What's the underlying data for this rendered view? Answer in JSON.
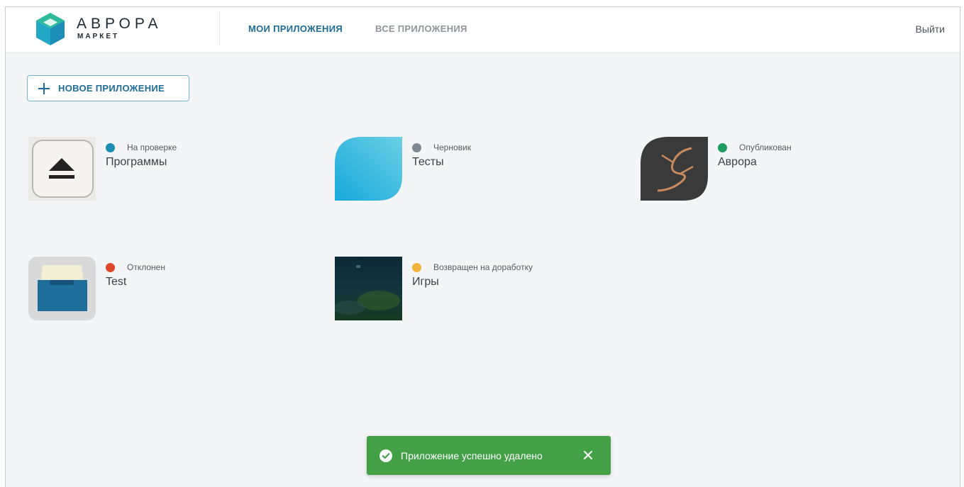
{
  "header": {
    "logo_title": "АВРОРА",
    "logo_subtitle": "МАРКЕТ",
    "tabs": [
      {
        "label": "МОИ ПРИЛОЖЕНИЯ",
        "active": true
      },
      {
        "label": "ВСЕ ПРИЛОЖЕНИЯ",
        "active": false
      }
    ],
    "logout_label": "Выйти"
  },
  "toolbar": {
    "new_app_label": "НОВОЕ ПРИЛОЖЕНИЕ",
    "new_app_icon": "plus-icon"
  },
  "apps": [
    {
      "name": "Программы",
      "status": "На проверке",
      "status_color": "#1e8db3",
      "icon": "eject-icon"
    },
    {
      "name": "Тесты",
      "status": "Черновик",
      "status_color": "#7d8892",
      "icon": "leaf-icon"
    },
    {
      "name": "Аврора",
      "status": "Опубликован",
      "status_color": "#1e9b5e",
      "icon": "bird-icon"
    },
    {
      "name": "Test",
      "status": "Отклонен",
      "status_color": "#e0462a",
      "icon": "drawer-icon"
    },
    {
      "name": "Игры",
      "status": "Возвращен на доработку",
      "status_color": "#f0b43c",
      "icon": "game-screenshot-icon"
    }
  ],
  "toast": {
    "message": "Приложение успешно удалено",
    "icon": "check-circle-icon",
    "close_icon": "close-icon",
    "color": "#43a047"
  }
}
